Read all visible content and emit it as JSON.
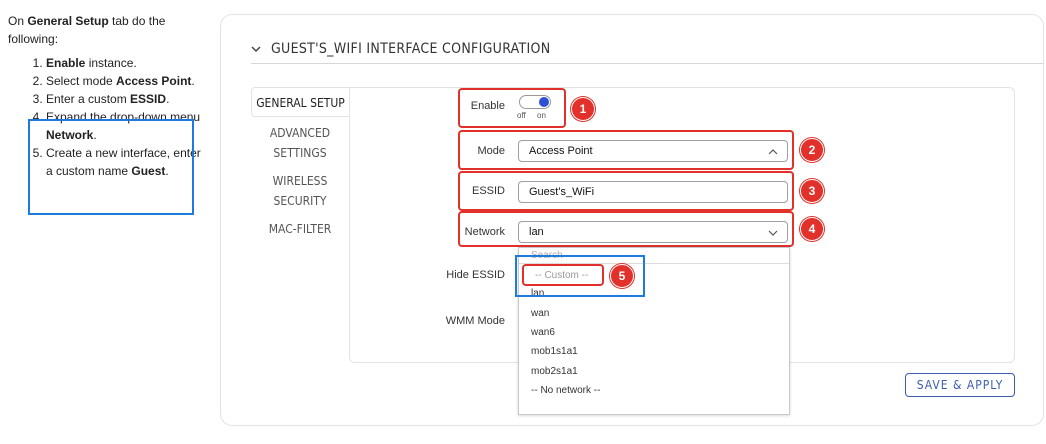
{
  "instructions": {
    "intro_prefix": "On ",
    "intro_bold": "General Setup",
    "intro_suffix": " tab do the following:",
    "steps": [
      {
        "bold": "Enable",
        "text": " instance.",
        "prefix": ""
      },
      {
        "prefix": "Select mode ",
        "bold": "Access Point",
        "text": "."
      },
      {
        "prefix": "Enter a custom ",
        "bold": "ESSID",
        "text": "."
      },
      {
        "prefix": "Expand the drop-down menu ",
        "bold": "Network",
        "text": "."
      },
      {
        "prefix": "Create a new interface, enter a custom name ",
        "bold": "Guest",
        "text": "."
      }
    ]
  },
  "section": {
    "title": "GUEST'S_WIFI INTERFACE CONFIGURATION"
  },
  "tabs": {
    "general": "GENERAL SETUP",
    "advanced_1": "ADVANCED",
    "advanced_2": "SETTINGS",
    "wireless_1": "WIRELESS",
    "wireless_2": "SECURITY",
    "mac": "MAC-FILTER"
  },
  "form": {
    "enable_label": "Enable",
    "toggle_off": "off",
    "toggle_on": "on",
    "mode_label": "Mode",
    "mode_value": "Access Point",
    "essid_label": "ESSID",
    "essid_value": "Guest's_WiFi",
    "network_label": "Network",
    "network_value": "lan",
    "hide_essid_label": "Hide ESSID",
    "wmm_label": "WMM Mode"
  },
  "dropdown": {
    "search_placeholder": "Search",
    "custom": "-- Custom --",
    "options": [
      "lan",
      "wan",
      "wan6",
      "mob1s1a1",
      "mob2s1a1",
      "-- No network --"
    ]
  },
  "badges": [
    "1",
    "2",
    "3",
    "4",
    "5"
  ],
  "buttons": {
    "save_apply": "SAVE & APPLY"
  },
  "colors": {
    "highlight_red": "#e2302b",
    "highlight_blue": "#1f7ae0",
    "toggle_knob": "#2d4fd6",
    "button_border": "#3c5cb0"
  }
}
